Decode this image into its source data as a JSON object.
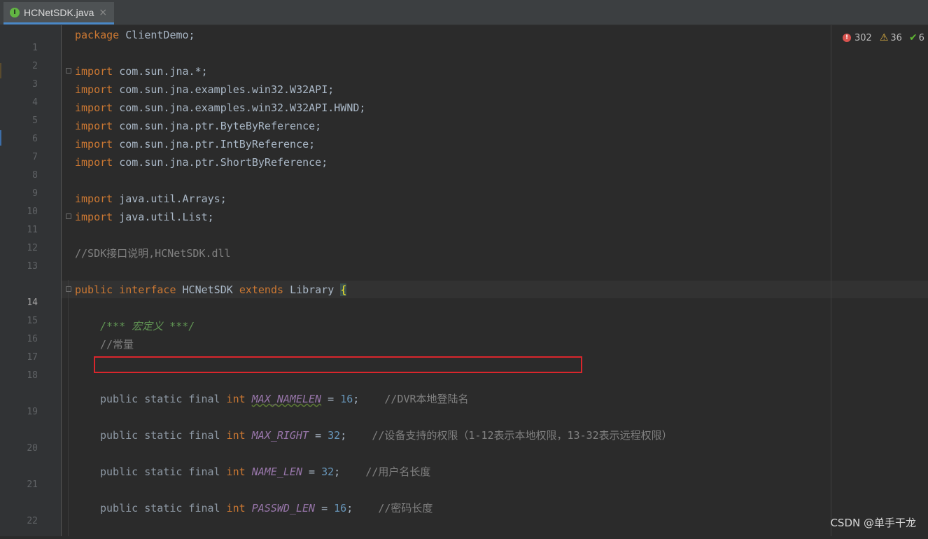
{
  "tab": {
    "label": "HCNetSDK.java",
    "icon": "I"
  },
  "inspections": {
    "errors": "302",
    "warnings": "36",
    "ok": "6"
  },
  "lines": {
    "l1": "1",
    "l2": "2",
    "l3": "3",
    "l4": "4",
    "l5": "5",
    "l6": "6",
    "l7": "7",
    "l8": "8",
    "l9": "9",
    "l10": "10",
    "l11": "11",
    "l12": "12",
    "l13": "13",
    "l14": "14",
    "l15": "15",
    "l16": "16",
    "l17": "17",
    "l18": "18",
    "l19": "19",
    "l20": "20",
    "l21": "21",
    "l22": "22"
  },
  "code": {
    "kw_package": "package",
    "package_name": " ClientDemo;",
    "kw_import": "import",
    "import1": " com.sun.jna.*;",
    "import2": " com.sun.jna.examples.win32.W32API;",
    "import3": " com.sun.jna.examples.win32.W32API.HWND;",
    "import4": " com.sun.jna.ptr.ByteByReference;",
    "import5": " com.sun.jna.ptr.IntByReference;",
    "import6": " com.sun.jna.ptr.ShortByReference;",
    "import7": " java.util.Arrays;",
    "import8": " java.util.List;",
    "comment_sdk": "//SDK接口说明,HCNetSDK.dll",
    "kw_public": "public",
    "kw_interface": "interface",
    "iface_name": "HCNetSDK",
    "kw_extends": "extends",
    "super_name": "Library",
    "brace": "{",
    "doc_macro": "/*** 宏定义 ***/",
    "comment_const": "//常量",
    "decl_prefix": "public static final",
    "kw_int": "int",
    "eq": "=",
    "c1_name": "MAX_NAMELEN",
    "c1_val": "16",
    "c1_cmt": "//DVR本地登陆名",
    "c2_name": "MAX_RIGHT",
    "c2_val": "32",
    "c2_cmt": "//设备支持的权限（1-12表示本地权限，13-32表示远程权限）",
    "c3_name": "NAME_LEN",
    "c3_val": "32",
    "c3_cmt": "//用户名长度",
    "c4_name": "PASSWD_LEN",
    "c4_val": "16",
    "c4_cmt": "//密码长度"
  },
  "watermark": "CSDN @单手干龙",
  "colors": {
    "editor_bg": "#2b2b2b",
    "keyword": "#cc7832",
    "comment": "#808080",
    "doc_comment": "#629755",
    "number": "#6897bb",
    "constant": "#9876aa",
    "highlight_box": "#d9262c"
  }
}
